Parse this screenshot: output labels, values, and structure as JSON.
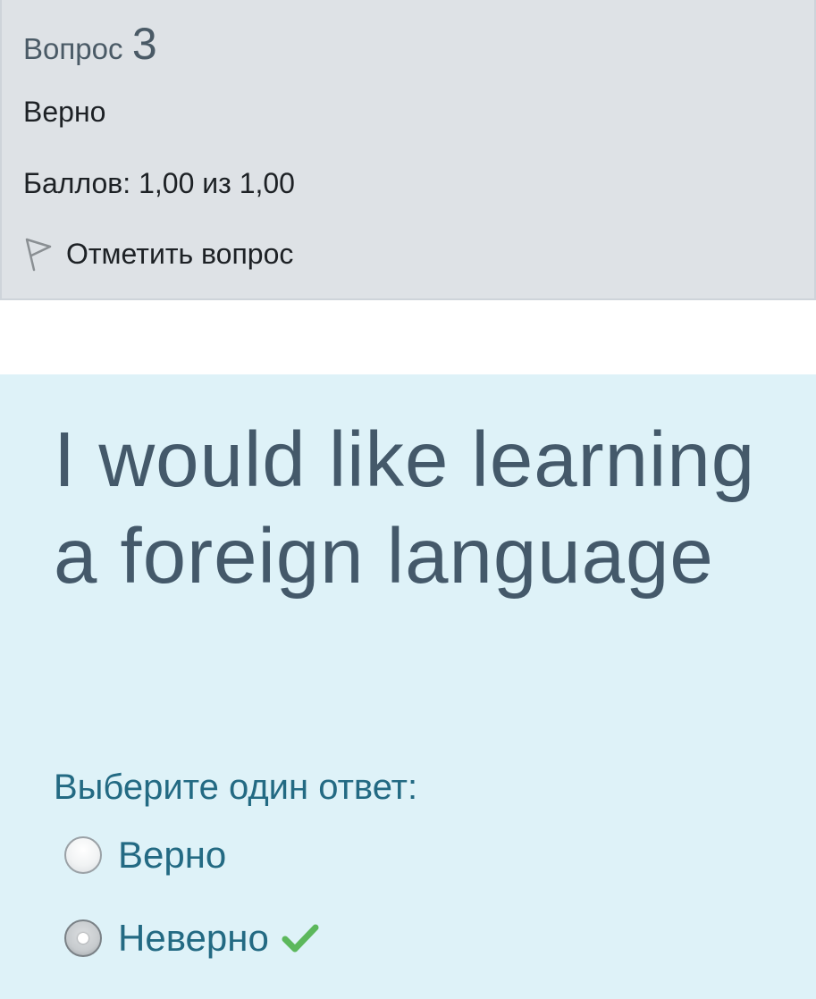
{
  "question_info": {
    "label": "Вопрос",
    "number": "3",
    "state": "Верно",
    "grade": "Баллов: 1,00 из 1,00",
    "flag_label": "Отметить вопрос",
    "flag_icon": "flag-outline-icon"
  },
  "question": {
    "text": "I would like learning a foreign language",
    "prompt": "Выберите один ответ:",
    "answers": [
      {
        "label": "Верно",
        "selected": false,
        "correct_mark": false
      },
      {
        "label": "Неверно",
        "selected": true,
        "correct_mark": true
      }
    ],
    "correct_icon": "checkmark-icon"
  },
  "colors": {
    "info_background": "#dee2e6",
    "content_background": "#def2f8",
    "question_text": "#44596a",
    "answer_text": "#236a83",
    "correct_check": "#5cb85c"
  }
}
